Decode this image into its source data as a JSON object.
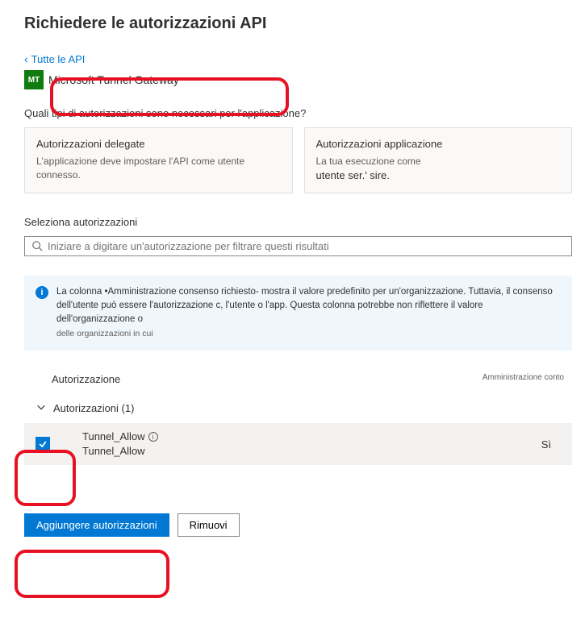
{
  "page_title": "Richiedere le autorizzazioni API",
  "breadcrumb": {
    "label": "Tutte le API"
  },
  "api": {
    "icon_text": "MT",
    "name": "Microsoft Tunnel Gateway"
  },
  "question": "Quali tipi di autorizzazioni sono necessari per l'applicazione?",
  "cards": {
    "delegated": {
      "title": "Autorizzazioni delegate",
      "desc": "L'applicazione deve impostare l'API come utente connesso."
    },
    "application": {
      "title": "Autorizzazioni applicazione",
      "desc_line1": "La tua esecuzione come",
      "desc_line2": "utente ser.' sire."
    }
  },
  "select_section": {
    "label": "Seleziona autorizzazioni",
    "search_placeholder": "Iniziare a digitare un'autorizzazione per filtrare questi risultati"
  },
  "info_banner": {
    "text_main": "La colonna •Amministrazione consenso richiesto- mostra il valore predefinito per un'organizzazione. Tuttavia, il consenso dell'utente può essere l'autorizzazione c, l'utente o l'app. Questa colonna potrebbe non riflettere il valore dell'organizzazione o",
    "text_small": "delle organizzazioni in cui"
  },
  "table": {
    "col_permission": "Autorizzazione",
    "col_admin": "Amministrazione conto",
    "group_label": "Autorizzazioni (1)",
    "row": {
      "name": "Tunnel_Allow",
      "desc": "Tunnel_Allow",
      "admin_consent": "Sì"
    }
  },
  "buttons": {
    "add": "Aggiungere autorizzazioni",
    "remove": "Rimuovi"
  }
}
